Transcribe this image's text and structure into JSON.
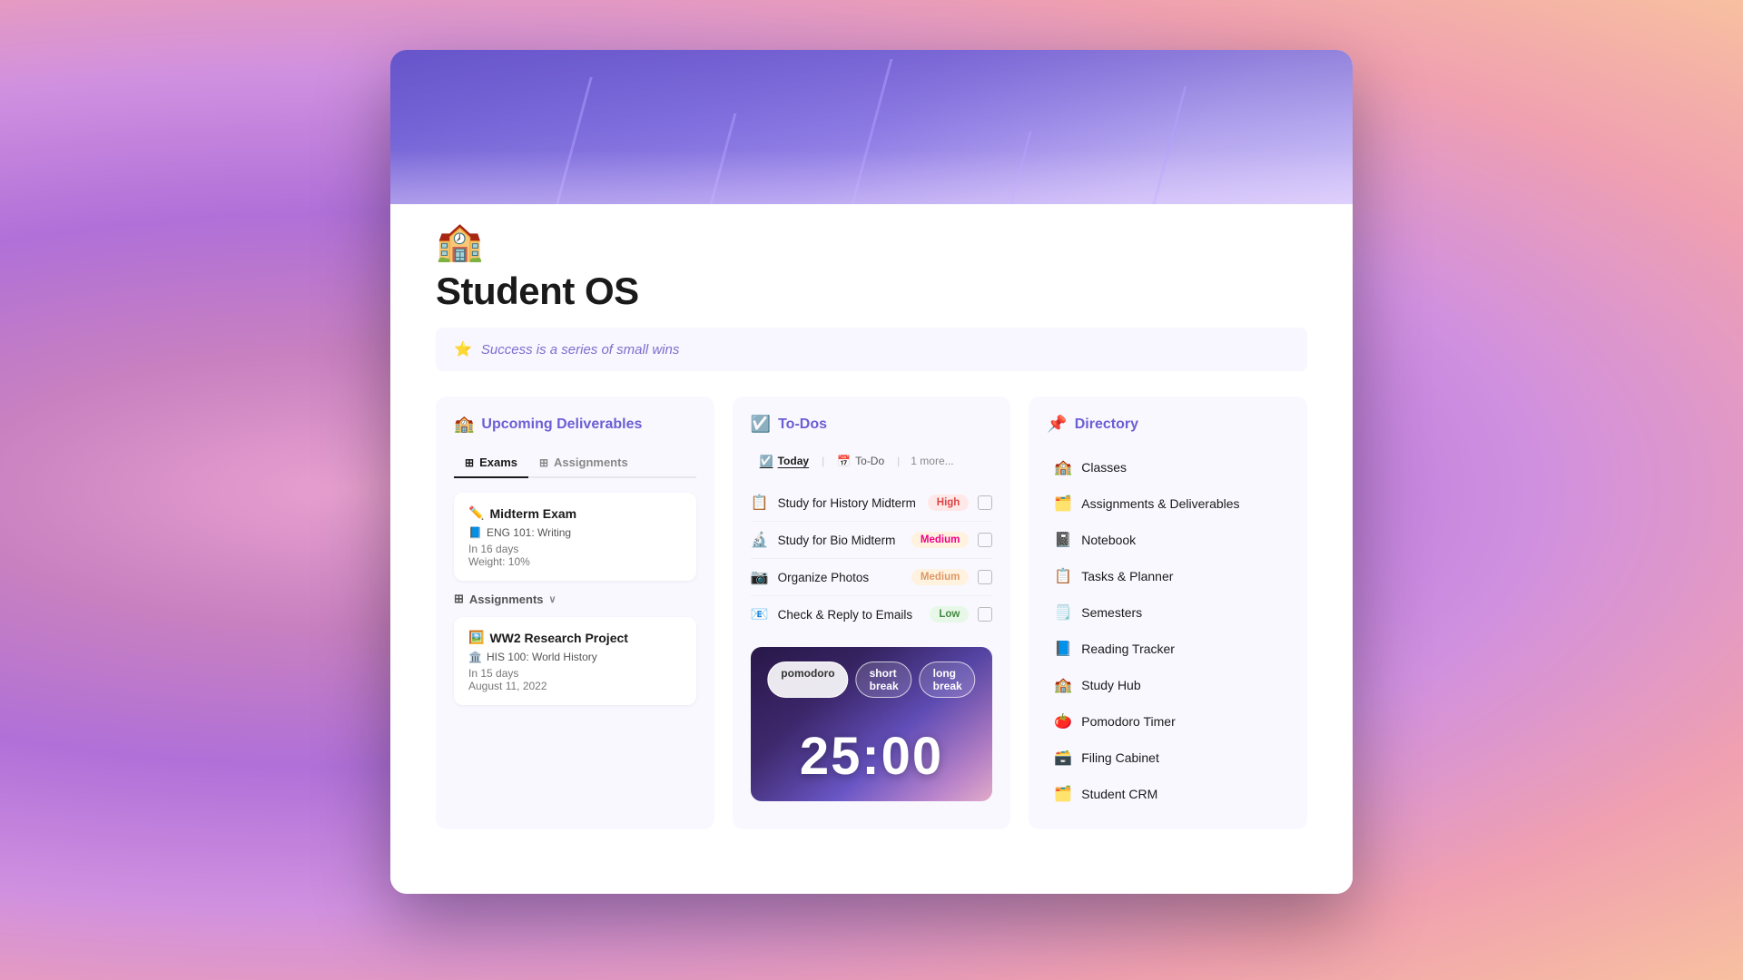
{
  "window": {
    "title": "Student OS"
  },
  "hero": {
    "school_emoji": "🏫"
  },
  "page": {
    "title": "Student OS",
    "quote_emoji": "⭐",
    "quote": "Success is a series of small wins"
  },
  "upcoming_deliverables": {
    "header_emoji": "🏫",
    "header_title": "Upcoming Deliverables",
    "tabs": [
      {
        "label": "Exams",
        "icon": "⊞",
        "active": true
      },
      {
        "label": "Assignments",
        "icon": "⊞",
        "active": false
      }
    ],
    "exams": [
      {
        "emoji": "✏️",
        "name": "Midterm Exam",
        "course_emoji": "📘",
        "course": "ENG 101: Writing",
        "days": "In 16 days",
        "weight": "Weight: 10%"
      }
    ],
    "assignments_label": "Assignments",
    "assignments": [
      {
        "emoji": "🖼️",
        "name": "WW2 Research Project",
        "course_emoji": "🏛️",
        "course": "HIS 100: World History",
        "days": "In 15 days",
        "date": "August 11, 2022"
      }
    ]
  },
  "todos": {
    "header_emoji": "☑️",
    "header_title": "To-Dos",
    "tabs": [
      {
        "label": "Today",
        "icon": "☑️",
        "active": true
      },
      {
        "label": "To-Do",
        "icon": "📅",
        "active": false
      },
      {
        "label": "1 more...",
        "active": false
      }
    ],
    "items": [
      {
        "emoji": "📋",
        "text": "Study for History Midterm",
        "priority": "High",
        "priority_class": "priority-high"
      },
      {
        "emoji": "🔬",
        "text": "Study for Bio Midterm",
        "priority": "Medium",
        "priority_class": "priority-medium"
      },
      {
        "emoji": "📷",
        "text": "Organize Photos",
        "priority": "Medium",
        "priority_class": "priority-medium-orange"
      },
      {
        "emoji": "📧",
        "text": "Check & Reply to Emails",
        "priority": "Low",
        "priority_class": "priority-low"
      }
    ],
    "pomodoro": {
      "tabs": [
        {
          "label": "pomodoro",
          "active": true
        },
        {
          "label": "short break",
          "active": false
        },
        {
          "label": "long break",
          "active": false
        }
      ],
      "timer": "25:00"
    }
  },
  "directory": {
    "header_emoji": "📌",
    "header_title": "Directory",
    "items": [
      {
        "emoji": "🏫",
        "label": "Classes"
      },
      {
        "emoji": "🗂️",
        "label": "Assignments & Deliverables"
      },
      {
        "emoji": "📓",
        "label": "Notebook"
      },
      {
        "emoji": "📋",
        "label": "Tasks & Planner"
      },
      {
        "emoji": "🗒️",
        "label": "Semesters"
      },
      {
        "emoji": "📘",
        "label": "Reading Tracker"
      },
      {
        "emoji": "🏫",
        "label": "Study Hub"
      },
      {
        "emoji": "🍅",
        "label": "Pomodoro Timer"
      },
      {
        "emoji": "🗃️",
        "label": "Filing Cabinet"
      },
      {
        "emoji": "🗂️",
        "label": "Student CRM"
      }
    ]
  }
}
